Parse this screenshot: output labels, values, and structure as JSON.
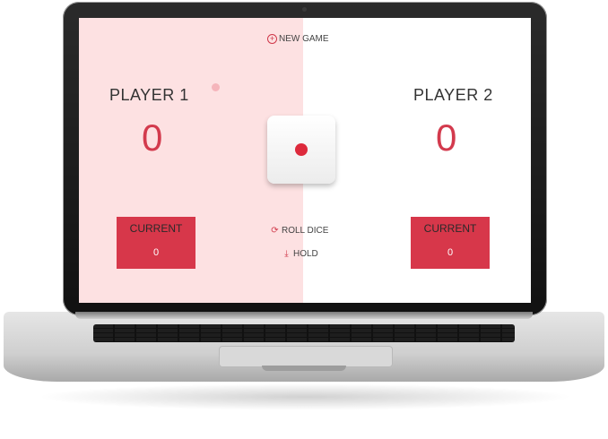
{
  "game": {
    "new_game_label": "NEW GAME",
    "roll_dice_label": "ROLL DICE",
    "hold_label": "HOLD",
    "current_label": "CURRENT",
    "dice_value": 1,
    "accent_color": "#d7374a",
    "active_bg_color": "#fde1e2"
  },
  "players": [
    {
      "name": "PLAYER 1",
      "score": "0",
      "current": "0",
      "active": true
    },
    {
      "name": "PLAYER 2",
      "score": "0",
      "current": "0",
      "active": false
    }
  ],
  "icons": {
    "new_game": "plus-circle-icon",
    "roll_dice": "refresh-icon",
    "hold": "download-icon"
  }
}
